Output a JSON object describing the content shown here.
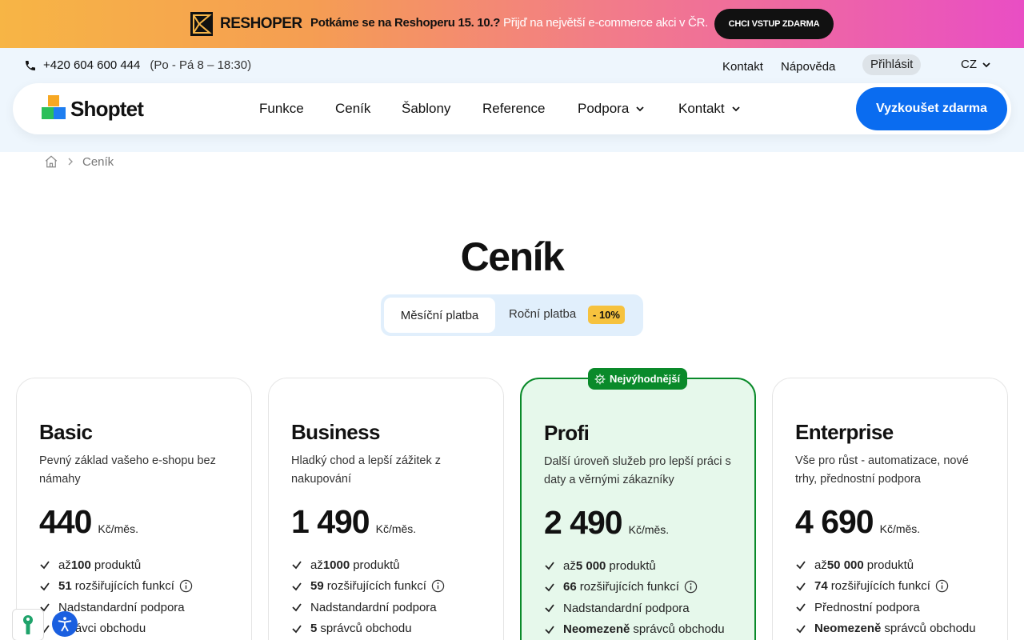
{
  "promo": {
    "brand": "RESHOPER",
    "text_bold": "Potkáme se na Reshoperu 15. 10.?",
    "text_rest": " Přijď na největší e-commerce akci v ČR.",
    "cta": "CHCI VSTUP ZDARMA"
  },
  "topbar": {
    "phone": "+420 604 600 444",
    "hours": "(Po - Pá 8 – 18:30)",
    "contact": "Kontakt",
    "help": "Nápověda",
    "login": "Přihlásit",
    "lang": "CZ"
  },
  "nav": {
    "logo": "Shoptet",
    "items": [
      "Funkce",
      "Ceník",
      "Šablony",
      "Reference",
      "Podpora",
      "Kontakt"
    ],
    "cta": "Vyzkoušet zdarma"
  },
  "breadcrumb": {
    "current": "Ceník"
  },
  "page": {
    "title": "Ceník"
  },
  "billing": {
    "monthly": "Měsíční platba",
    "yearly": "Roční platba",
    "discount": "- 10%"
  },
  "badge_best": "Nejvýhodnější",
  "plans": [
    {
      "name": "Basic",
      "desc": "Pevný základ vašeho e-shopu bez námahy",
      "price": "440",
      "unit": "Kč/měs.",
      "features": [
        {
          "pre": "až ",
          "bold": "100",
          "text": "produktů"
        },
        {
          "pre": "",
          "bold": "51",
          "text": "rozšiřujících funkcí"
        },
        {
          "pre": "",
          "bold": "",
          "text": "Nadstandardní podpora"
        },
        {
          "pre": "",
          "bold": "",
          "text": "správci obchodu"
        }
      ]
    },
    {
      "name": "Business",
      "desc": "Hladký chod a lepší zážitek z nakupování",
      "price": "1 490",
      "unit": "Kč/měs.",
      "features": [
        {
          "pre": "až ",
          "bold": "1000",
          "text": "produktů"
        },
        {
          "pre": "",
          "bold": "59",
          "text": "rozšiřujících funkcí"
        },
        {
          "pre": "",
          "bold": "",
          "text": "Nadstandardní podpora"
        },
        {
          "pre": "",
          "bold": "5",
          "text": "správců obchodu"
        }
      ]
    },
    {
      "name": "Profi",
      "desc": "Další úroveň služeb pro lepší práci s daty a věrnými zákazníky",
      "price": "2 490",
      "unit": "Kč/měs.",
      "features": [
        {
          "pre": "až ",
          "bold": "5 000",
          "text": "produktů"
        },
        {
          "pre": "",
          "bold": "66",
          "text": "rozšiřujících funkcí"
        },
        {
          "pre": "",
          "bold": "",
          "text": "Nadstandardní podpora"
        },
        {
          "pre": "",
          "bold": "Neomezeně",
          "text": "správců obchodu"
        }
      ]
    },
    {
      "name": "Enterprise",
      "desc": "Vše pro růst - automatizace, nové trhy, přednostní podpora",
      "price": "4 690",
      "unit": "Kč/měs.",
      "features": [
        {
          "pre": "až ",
          "bold": "50 000",
          "text": "produktů"
        },
        {
          "pre": "",
          "bold": "74",
          "text": "rozšiřujících funkcí"
        },
        {
          "pre": "",
          "bold": "",
          "text": "Přednostní podpora"
        },
        {
          "pre": "",
          "bold": "Neomezeně",
          "text": "správců obchodu"
        }
      ]
    }
  ],
  "colors": {
    "brand_blue": "#0a6cf0",
    "best_green": "#0a8a2a",
    "best_bg": "#e6f8eb",
    "discount_yellow": "#f6c23e",
    "logo_orange": "#f7a823",
    "logo_green": "#2bbf5a",
    "logo_blue": "#1e7ef0"
  }
}
